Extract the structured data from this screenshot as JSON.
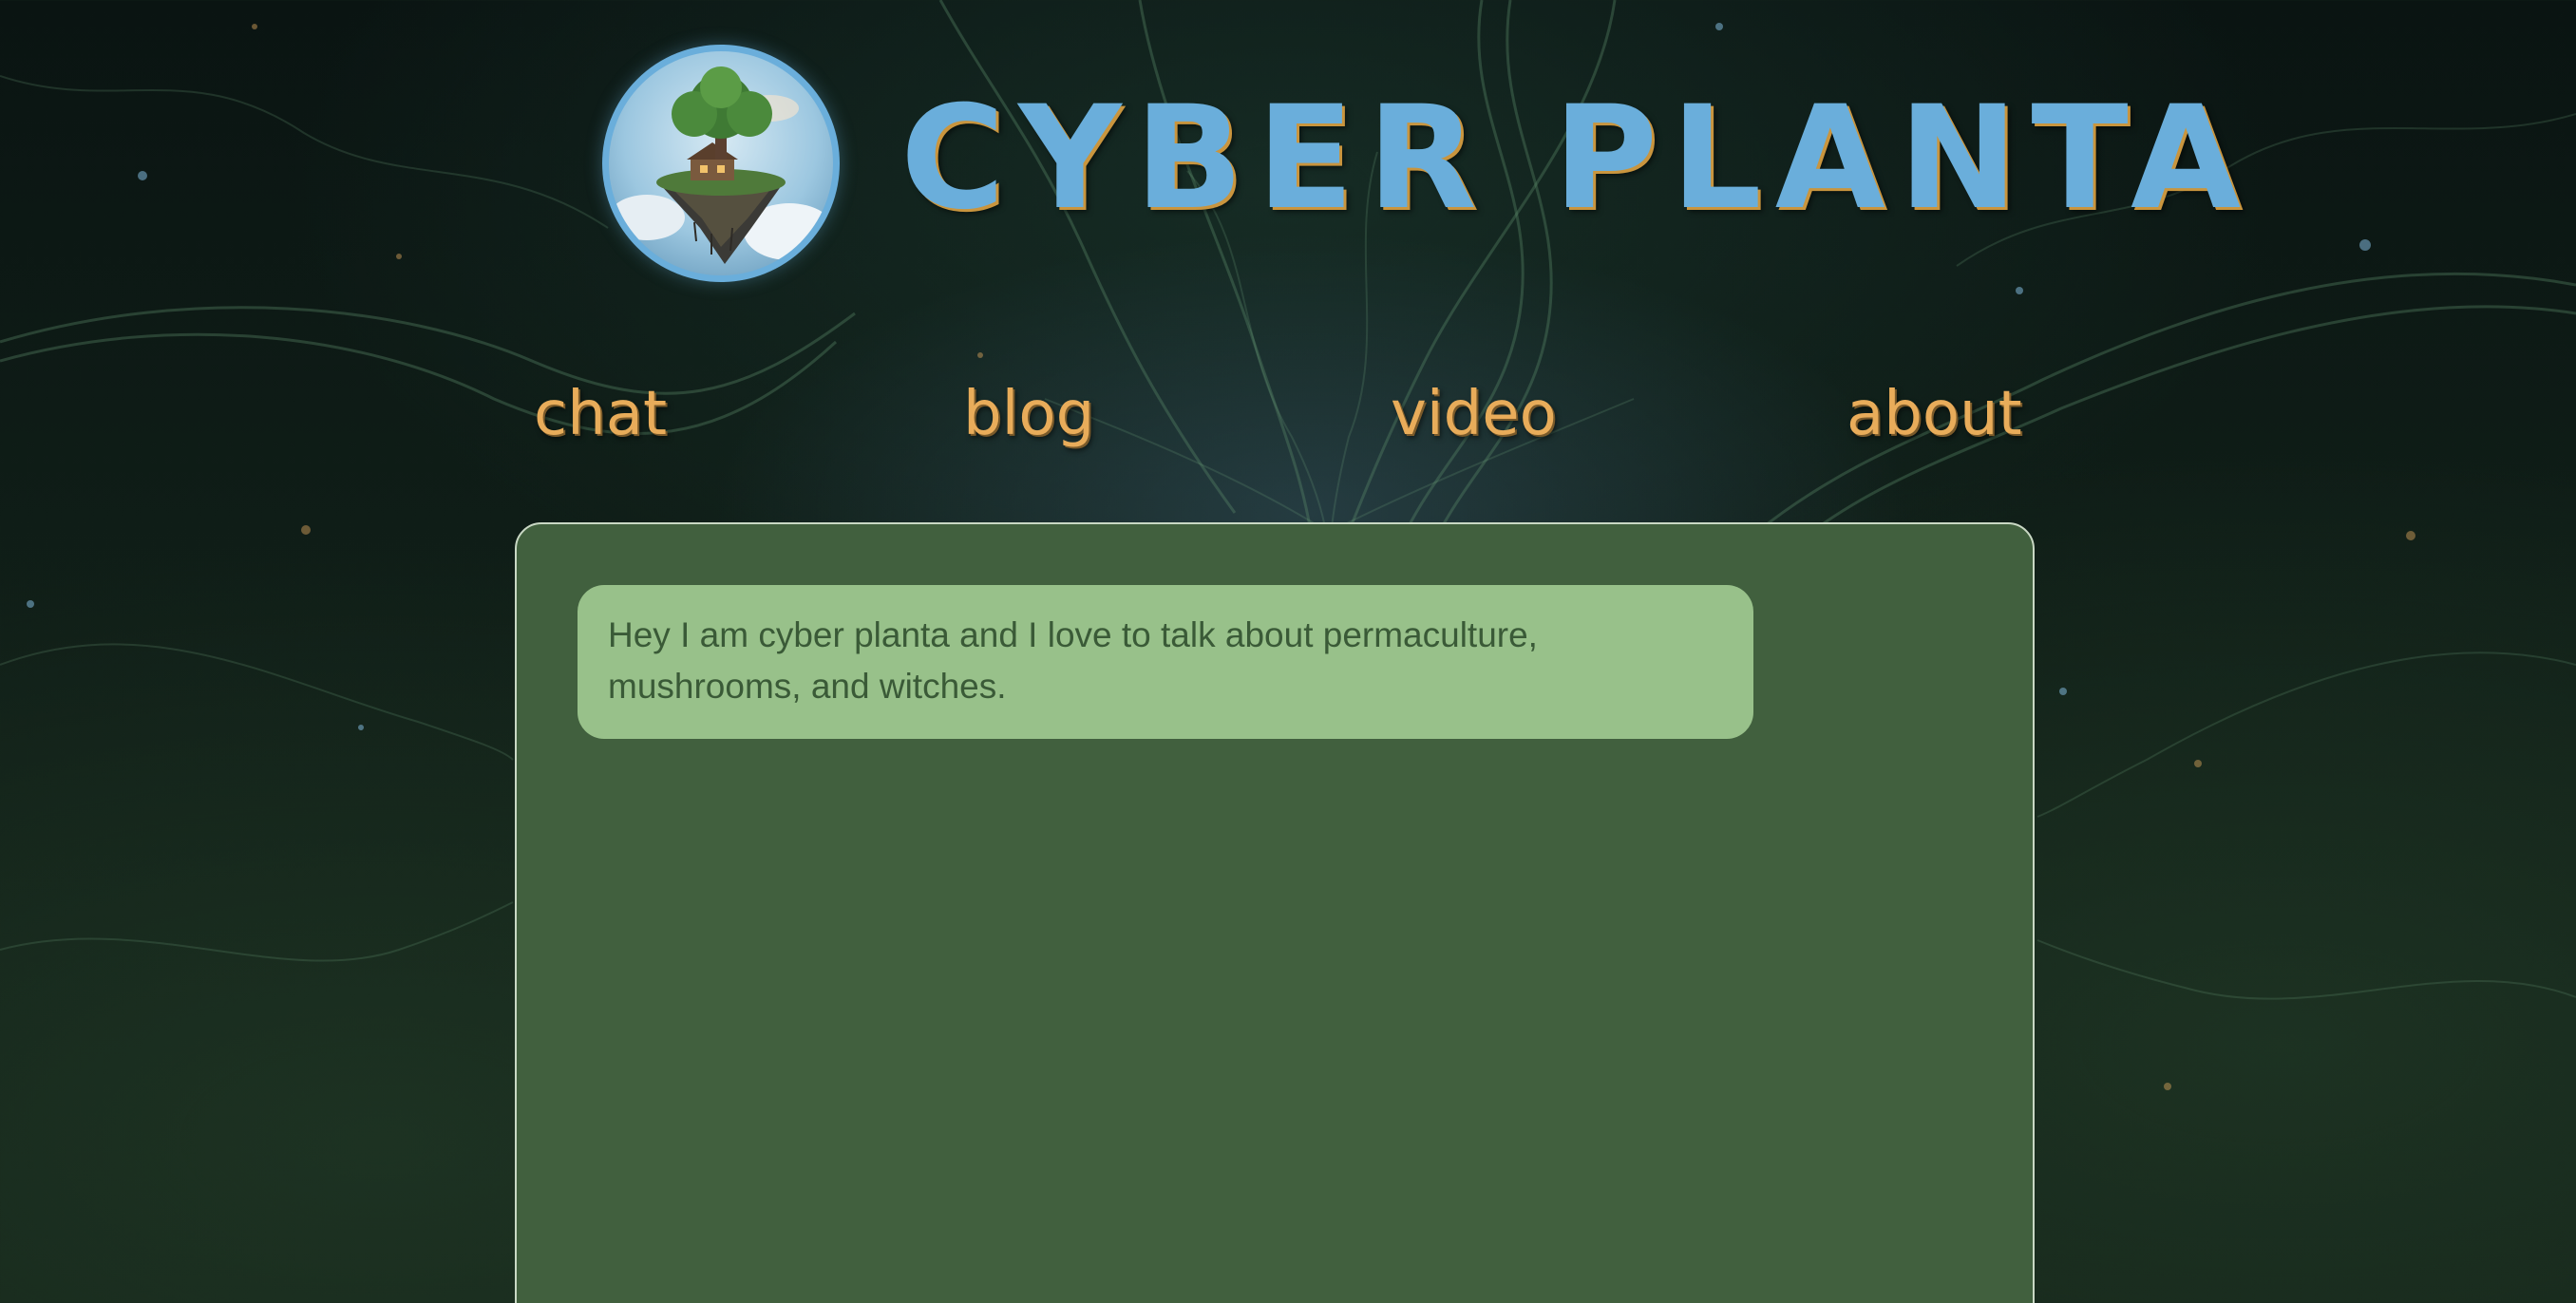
{
  "site": {
    "title": "CYBER PLANTA",
    "logo_icon": "floating-island-tree-icon"
  },
  "nav": {
    "items": [
      {
        "label": "chat"
      },
      {
        "label": "blog"
      },
      {
        "label": "video"
      },
      {
        "label": "about"
      }
    ]
  },
  "chat": {
    "messages": [
      {
        "text": "Hey I am cyber planta and I love to talk about permaculture, mushrooms, and witches."
      }
    ]
  },
  "colors": {
    "title": "#6aaedb",
    "nav": "#e8ac5a",
    "panel": "#41603e",
    "bubble": "#98c18a",
    "bubble_text": "#3a5a37"
  }
}
